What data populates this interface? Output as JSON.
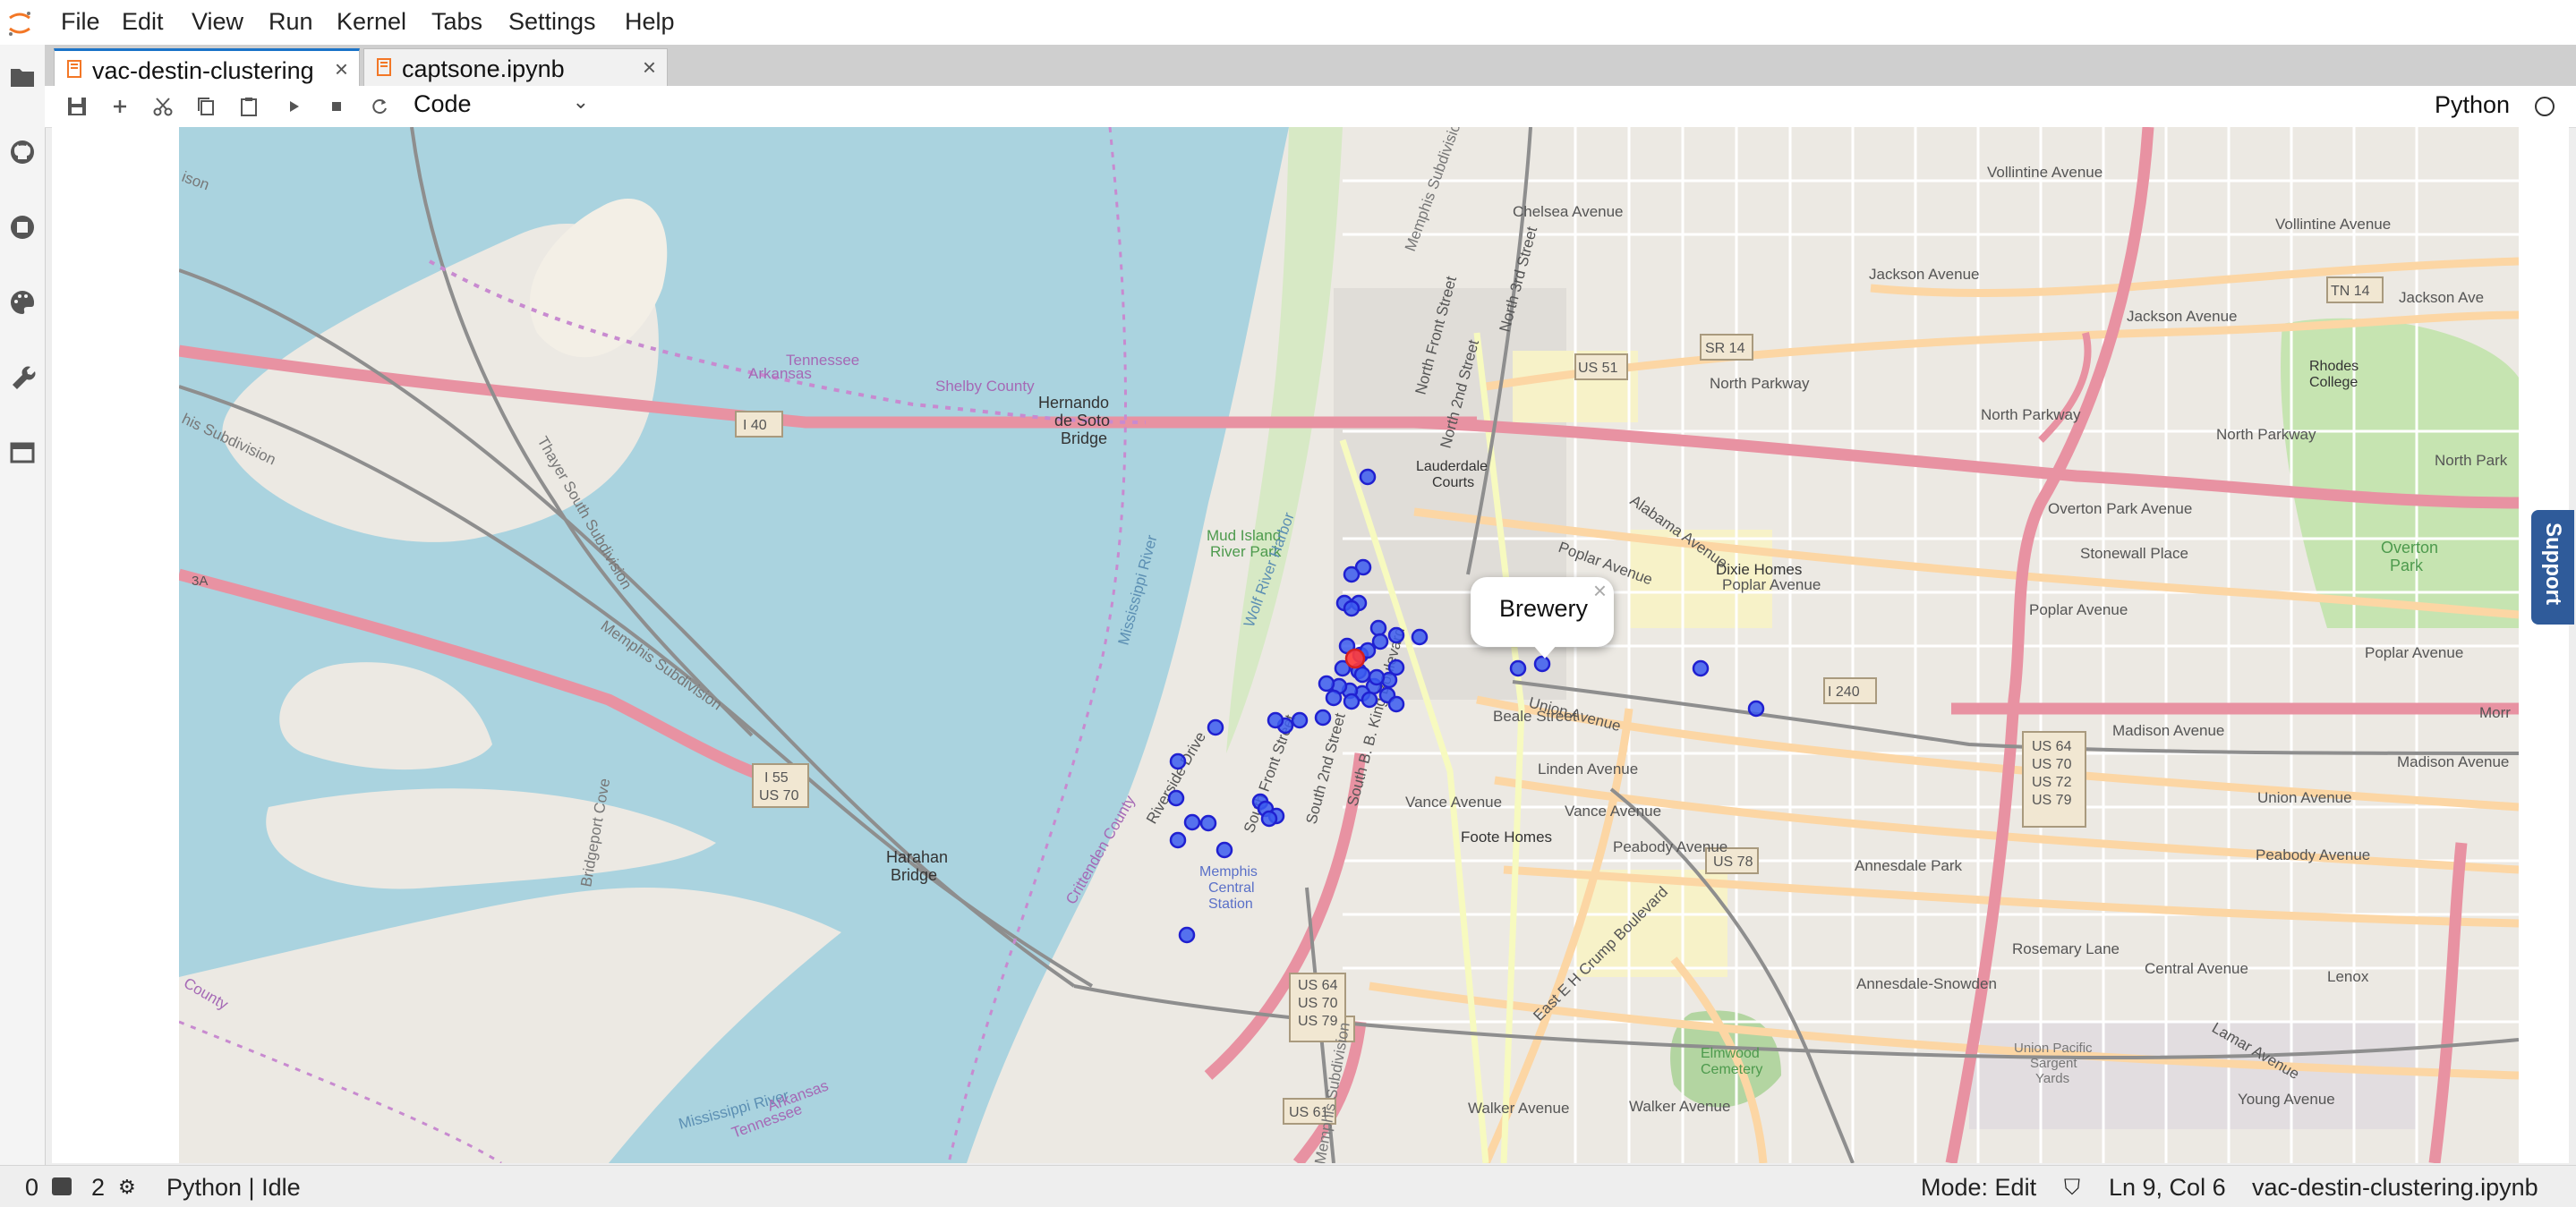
{
  "menubar": {
    "items": [
      "File",
      "Edit",
      "View",
      "Run",
      "Kernel",
      "Tabs",
      "Settings",
      "Help"
    ]
  },
  "sidebar": {
    "icons": [
      "folder-icon",
      "github-icon",
      "running-kernels-icon",
      "palette-icon",
      "wrench-icon",
      "tabs-icon"
    ]
  },
  "tabs": [
    {
      "label": "vac-destin-clustering",
      "active": true
    },
    {
      "label": "captsone.ipynb",
      "active": false
    }
  ],
  "toolbar": {
    "cell_type": "Code",
    "kernel_name": "Python"
  },
  "map": {
    "labels": {
      "tennessee": "Tennessee",
      "arkansas": "Arkansas",
      "shelby_county": "Shelby County",
      "hernando_bridge": "Hernando\nde Soto\nBridge",
      "i40": "I 40",
      "mud_island": "Mud Island\nRiver Park",
      "wolf_river": "Wolf River Harbor",
      "mississippi_river_1": "Mississippi River",
      "mississippi_river_2": "Mississippi River",
      "lauderdale_courts": "Lauderdale\nCourts",
      "us51": "US 51",
      "sr14": "SR 14",
      "north_parkway_1": "North Parkway",
      "north_parkway_2": "North Parkway",
      "north_parkway_3": "North Parkway",
      "north_parkway_4": "North Park",
      "jackson_avenue_1": "Jackson Avenue",
      "jackson_avenue_2": "Jackson Avenue",
      "jackson_avenue_3": "Jackson Ave",
      "tn14": "TN 14",
      "chelsea_avenue": "Chelsea Avenue",
      "vollintine_1": "Vollintine Avenue",
      "vollintine_2": "Vollintine Avenue",
      "rhodes_college": "Rhodes\nCollege",
      "overton_park_ave": "Overton Park Avenue",
      "overton_park": "Overton\nPark",
      "stonewall_place": "Stonewall Place",
      "dixie_homes": "Dixie Homes",
      "poplar_avenue_1": "Poplar Avenue",
      "poplar_avenue_2": "Poplar Avenue",
      "poplar_avenue_3": "Poplar Avenue",
      "poplar_avenue_4": "Poplar Avenue",
      "alabama_avenue": "Alabama Avenue",
      "i240": "I 240",
      "madison_avenue_1": "Madison Avenue",
      "madison_avenue_2": "Madison Avenue",
      "union_avenue_1": "Union Avenue",
      "union_avenue_2": "Union Avenue",
      "beale_street": "Beale Street",
      "linden_avenue": "Linden Avenue",
      "vance_avenue_1": "Vance Avenue",
      "vance_avenue_2": "Vance Avenue",
      "foote_homes": "Foote Homes",
      "us78": "US 78",
      "us_shield_east": "US 64\nUS 70\nUS 72\nUS 79",
      "us_shield_south": "US 64\nUS 70\nUS 79",
      "us61": "US 61",
      "i55": "I 55\nUS 70",
      "harahan_bridge": "Harahan\nBridge",
      "memphis_central_station": "Memphis\nCentral\nStation",
      "peabody_avenue_1": "Peabody Avenue",
      "peabody_avenue_2": "Peabody Avenue",
      "annesdale_park": "Annesdale Park",
      "annesdale_snowden": "Annesdale-Snowden",
      "rosemary_lane": "Rosemary Lane",
      "central_avenue": "Central Avenue",
      "lenox": "Lenox",
      "elmwood_cemetery": "Elmwood\nCemetery",
      "union_pacific_yards": "Union Pacific\nSargent\nYards",
      "walker_avenue_1": "Walker Avenue",
      "walker_avenue_2": "Walker Avenue",
      "young_avenue": "Young Avenue",
      "ej_crump": "East E H Crump Boulevard",
      "lamar_avenue": "Lamar Avenue",
      "riverside_drive": "Riverside Drive",
      "north_front_street": "North Front Street",
      "north_2nd_street": "North 2nd Street",
      "north_3rd_street": "North 3rd Street",
      "south_2nd_street": "South 2nd Street",
      "south_front_street": "South Front Street",
      "sbb_king": "South B. B. King Boulevard",
      "memphis_subdivision_1": "Memphis Subdivision",
      "memphis_subdivision_2": "Memphis Subdivision",
      "memphis_subdivision_3": "Memphis Subdivision",
      "thayer_subdivision": "Thayer South Subdivision",
      "bridgeport_cove": "Bridgeport Cove",
      "crittenden_county": "Crittenden County",
      "county_left": "County",
      "arkansas_bottom": "Arkansas",
      "tennessee_bottom": "Tennessee",
      "mor": "Morr",
      "i3a": "3A",
      "ison": "ison",
      "subdivision_left": "his Subdivision"
    },
    "popup": {
      "text": "Brewery",
      "close": "×"
    }
  },
  "support": {
    "label": "Support"
  },
  "statusbar": {
    "zero": "0",
    "terminals": "2",
    "kernel": "Python | Idle",
    "mode": "Mode: Edit",
    "position": "Ln 9, Col 6",
    "filename": "vac-destin-clustering.ipynb"
  }
}
